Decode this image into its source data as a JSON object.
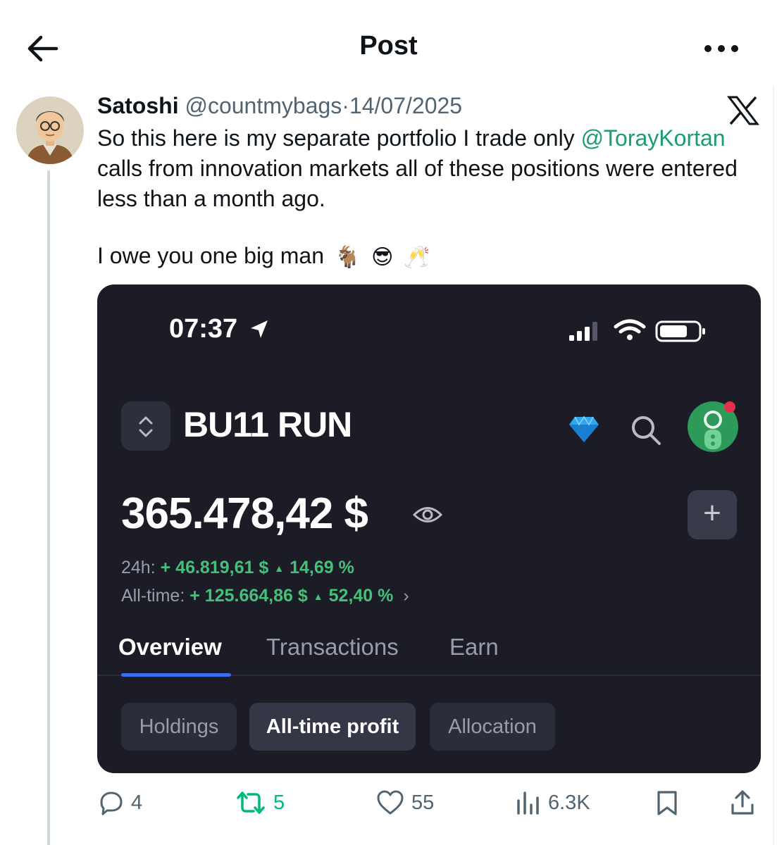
{
  "header": {
    "title": "Post"
  },
  "post": {
    "author_name": "Satoshi",
    "handle": "@countmybags",
    "separator": "·",
    "date": "14/07/2025",
    "text_before_mention": "So this here is my separate portfolio I trade only ",
    "mention": "@TorayKortan",
    "text_after_mention": " calls from innovation markets all of these positions were entered less than a month ago.",
    "text_line2": "I owe you one big man",
    "emojis": [
      "🐐",
      "😎",
      "🥂"
    ]
  },
  "card": {
    "time": "07:37",
    "account_name": "BU11 RUN",
    "balance": "365.478,42 $",
    "row_24h": {
      "label": "24h:",
      "amount": "+ 46.819,61 $",
      "percent": "14,69 %"
    },
    "row_alltime": {
      "label": "All-time:",
      "amount": "+ 125.664,86 $",
      "percent": "52,40 %"
    },
    "add_label": "+",
    "tabs": [
      "Overview",
      "Transactions",
      "Earn"
    ],
    "chips": [
      "Holdings",
      "All-time profit",
      "Allocation"
    ]
  },
  "actions": {
    "replies": "4",
    "reposts": "5",
    "likes": "55",
    "views": "6.3K"
  },
  "colors": {
    "mention": "#1a9d6f",
    "card_bg": "#1b1c26",
    "positive": "#44c07a",
    "tab_indicator": "#3b6ff0",
    "repost_green": "#00ba7c"
  }
}
